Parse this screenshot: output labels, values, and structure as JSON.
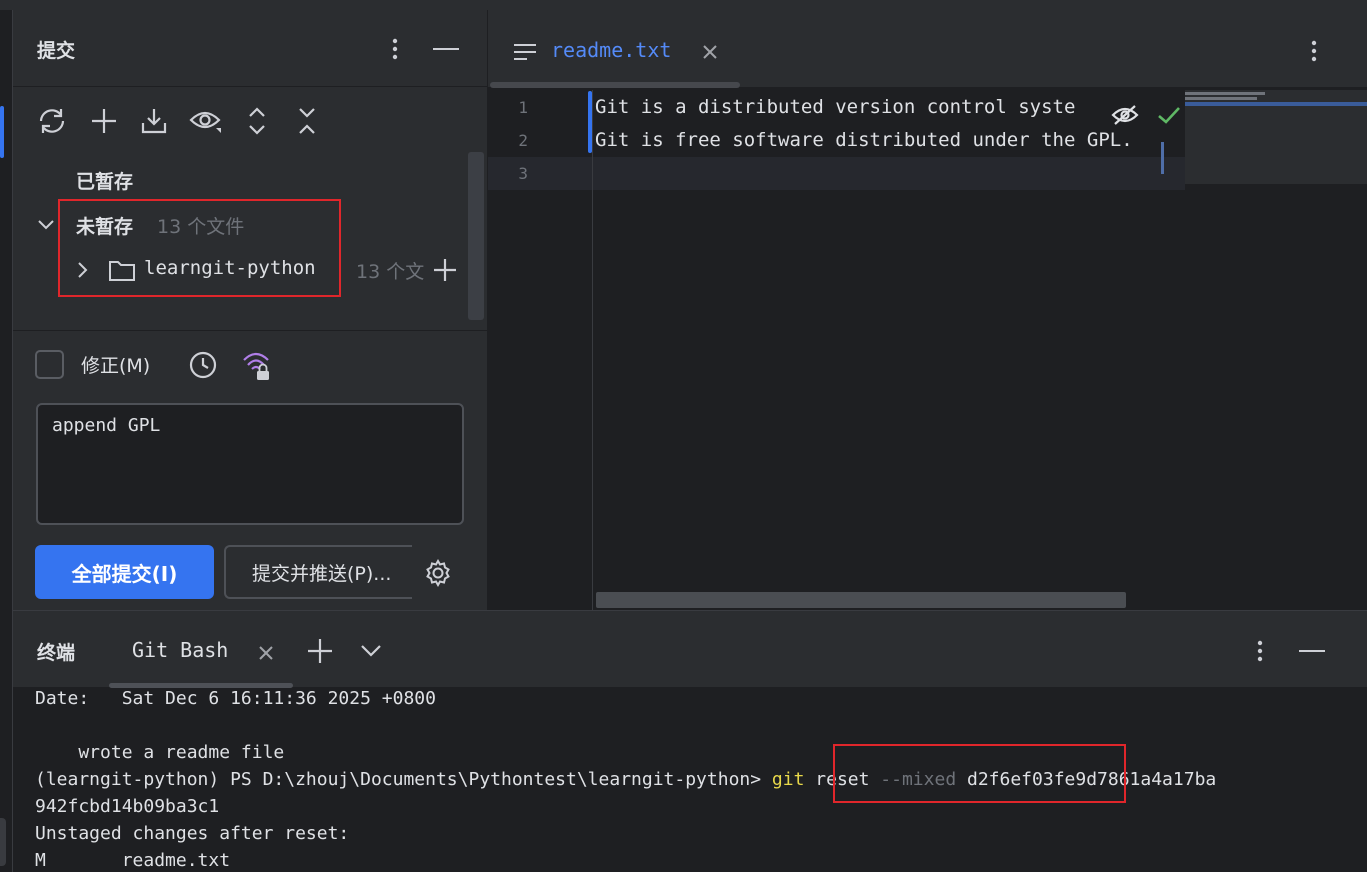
{
  "commit_panel": {
    "title": "提交",
    "staged_label": "已暂存",
    "unstaged_label": "未暂存",
    "unstaged_count": "13 个文件",
    "folder_name": "learngit-python",
    "folder_count": "13 个文",
    "amend_label": "修正(M)",
    "commit_message": "append GPL",
    "commit_all_button": "全部提交(I)",
    "commit_push_button": "提交并推送(P)..."
  },
  "editor": {
    "tab_name": "readme.txt",
    "lines": [
      {
        "no": "1",
        "text": "Git is a distributed version control syste"
      },
      {
        "no": "2",
        "text": "Git is free software distributed under the GPL."
      },
      {
        "no": "3",
        "text": ""
      }
    ]
  },
  "terminal": {
    "title": "终端",
    "tab_name": "Git Bash",
    "lines": {
      "l1": "Date:   Sat Dec 6 16:11:36 2025 +0800",
      "l2": "",
      "l3": "    wrote a readme file",
      "prompt": "(learngit-python) PS D:\\zhouj\\Documents\\Pythontest\\learngit-python> ",
      "cmd": "git",
      "cmd_arg1": " reset ",
      "cmd_flag": "--mixed",
      "cmd_hash": " d2f6ef03fe9d7861a4a17ba",
      "l5": "942fcbd14b09ba3c1",
      "l6": "Unstaged changes after reset:",
      "l7": "M       readme.txt"
    }
  },
  "colors": {
    "accent": "#3574f0",
    "highlight_box": "#e0262b",
    "terminal_command": "#e8d84a"
  }
}
